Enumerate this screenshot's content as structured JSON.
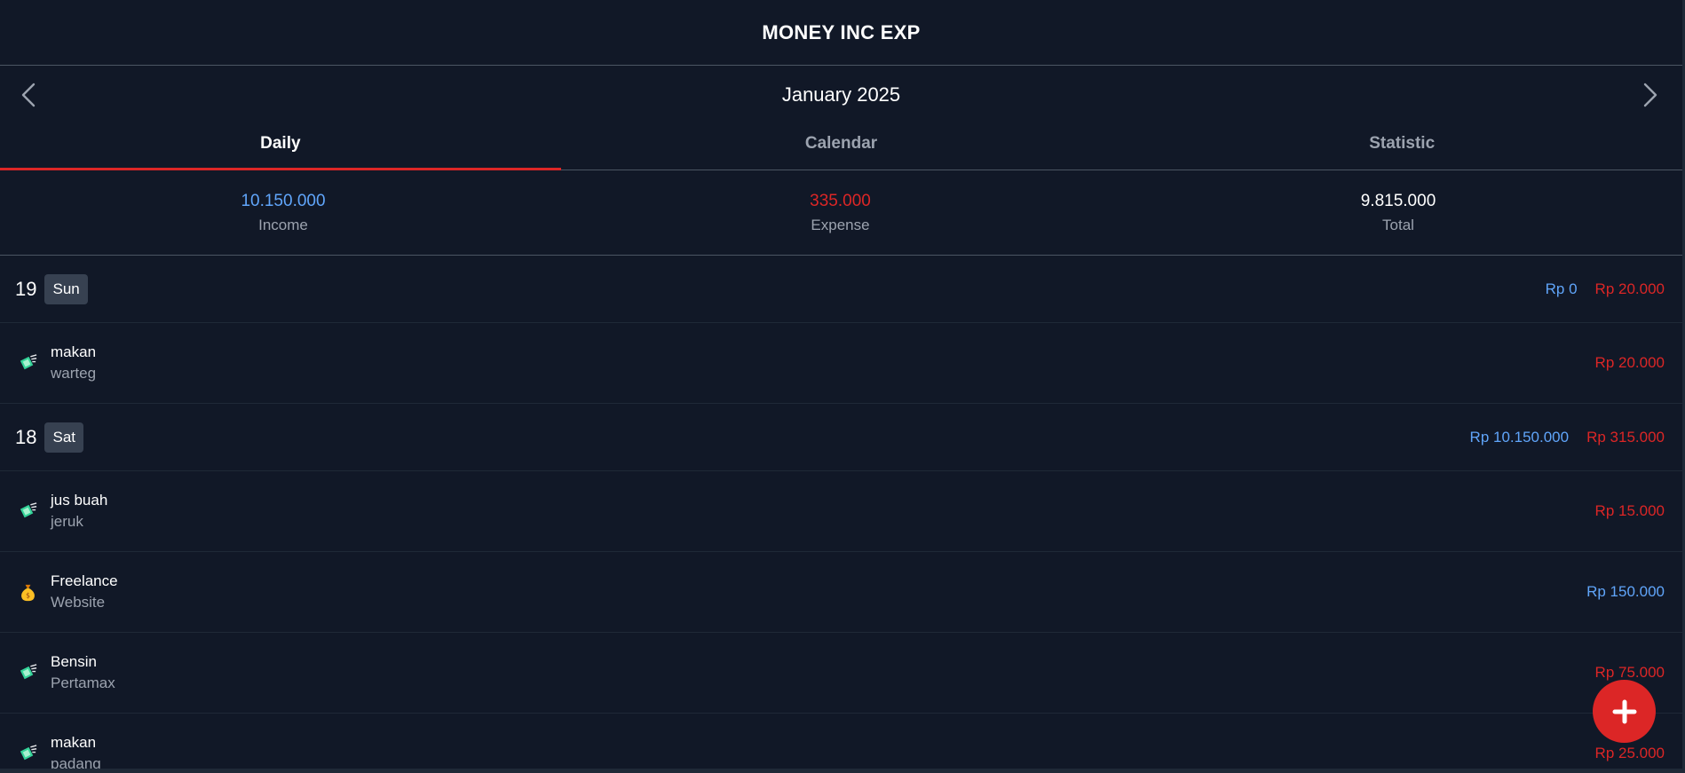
{
  "app": {
    "title": "MONEY INC EXP"
  },
  "nav": {
    "month": "January 2025",
    "prev_icon": "chevron-left-icon",
    "next_icon": "chevron-right-icon"
  },
  "tabs": [
    {
      "label": "Daily",
      "active": true
    },
    {
      "label": "Calendar",
      "active": false
    },
    {
      "label": "Statistic",
      "active": false
    }
  ],
  "summary": {
    "income": {
      "value": "10.150.000",
      "label": "Income"
    },
    "expense": {
      "value": "335.000",
      "label": "Expense"
    },
    "total": {
      "value": "9.815.000",
      "label": "Total"
    }
  },
  "days": [
    {
      "day": "19",
      "weekday": "Sun",
      "income": "Rp 0",
      "expense": "Rp 20.000",
      "transactions": [
        {
          "icon": "money-with-wings-icon",
          "title": "makan",
          "note": "warteg",
          "amount": "Rp 20.000",
          "type": "expense"
        }
      ]
    },
    {
      "day": "18",
      "weekday": "Sat",
      "income": "Rp 10.150.000",
      "expense": "Rp 315.000",
      "transactions": [
        {
          "icon": "money-with-wings-icon",
          "title": "jus buah",
          "note": "jeruk",
          "amount": "Rp 15.000",
          "type": "expense"
        },
        {
          "icon": "money-bag-icon",
          "title": "Freelance",
          "note": "Website",
          "amount": "Rp 150.000",
          "type": "income"
        },
        {
          "icon": "money-with-wings-icon",
          "title": "Bensin",
          "note": "Pertamax",
          "amount": "Rp 75.000",
          "type": "expense"
        },
        {
          "icon": "money-with-wings-icon",
          "title": "makan",
          "note": "padang",
          "amount": "Rp 25.000",
          "type": "expense"
        }
      ]
    }
  ],
  "fab": {
    "icon": "plus-icon"
  },
  "colors": {
    "background": "#111827",
    "accent": "#dc2626",
    "income": "#60a5fa",
    "expense": "#dc2626",
    "muted": "#9ca3af",
    "border": "#4b5563"
  }
}
